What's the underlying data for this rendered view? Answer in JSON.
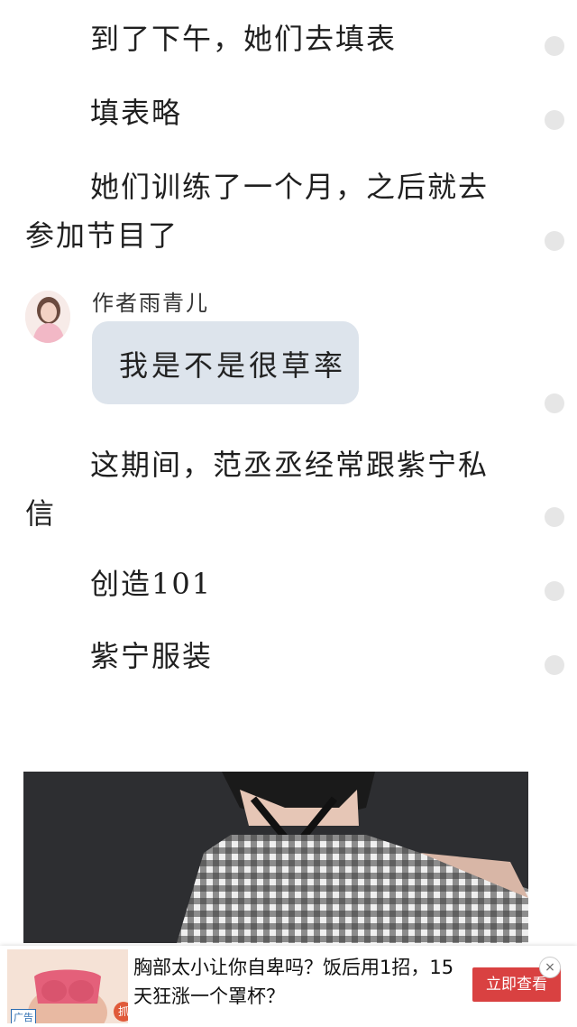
{
  "paragraphs": [
    "到了下午，她们去填表",
    "填表略",
    "她们训练了一个月，之后就去参加节目了",
    "这期间，范丞丞经常跟紫宁私信",
    "创造101",
    "紫宁服装"
  ],
  "author_comment": {
    "name": "作者雨青儿",
    "text": "我是不是很草率"
  },
  "ad": {
    "text": "胸部太小让你自卑吗？饭后用1招，15天狂涨一个罩杯？",
    "button": "立即查看",
    "tag": "广告",
    "grab_label": "抓",
    "close_symbol": "×"
  },
  "colors": {
    "bubble": "#dde4ec",
    "ad_button": "#d94141",
    "dot": "#e6e6e6"
  }
}
